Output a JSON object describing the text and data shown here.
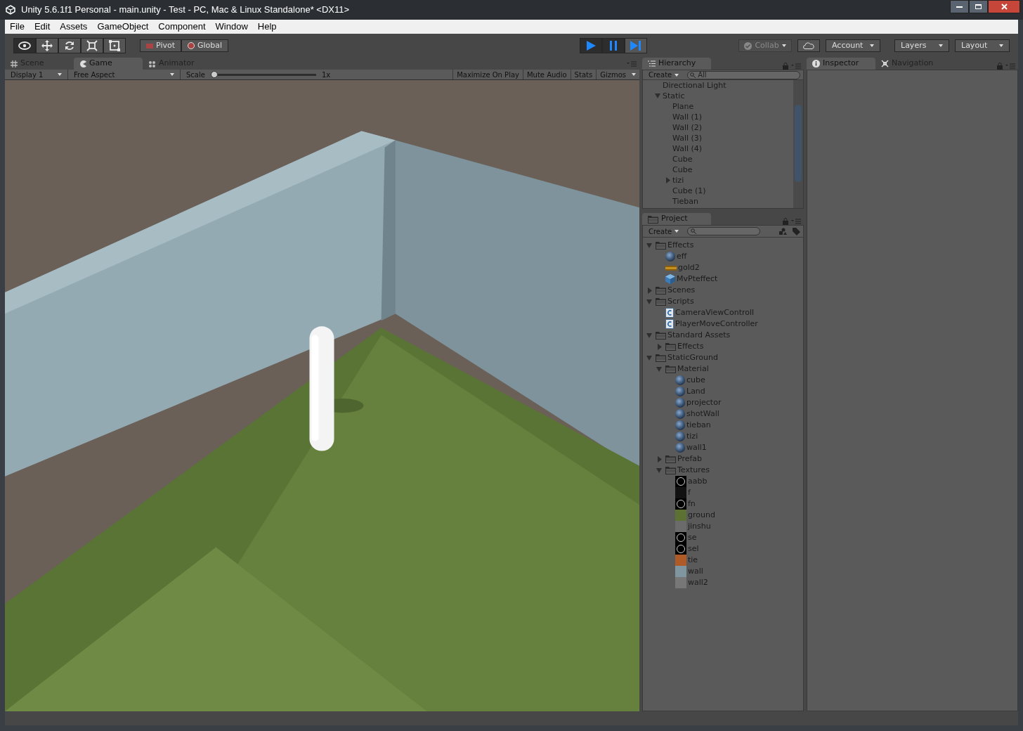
{
  "window": {
    "title": "Unity 5.6.1f1 Personal - main.unity - Test - PC, Mac & Linux Standalone* <DX11>"
  },
  "menu": [
    "File",
    "Edit",
    "Assets",
    "GameObject",
    "Component",
    "Window",
    "Help"
  ],
  "tools": [
    {
      "kind": "view",
      "selected": true
    },
    {
      "kind": "move",
      "selected": false
    },
    {
      "kind": "rotate",
      "selected": false
    },
    {
      "kind": "scale",
      "selected": false
    },
    {
      "kind": "rect",
      "selected": false
    }
  ],
  "pivot": {
    "pivot": "Pivot",
    "space": "Global"
  },
  "playback": [
    {
      "kind": "play",
      "on": true
    },
    {
      "kind": "pause",
      "on": true
    },
    {
      "kind": "step",
      "on": false
    }
  ],
  "right_toolbar": {
    "collab": "Collab",
    "collab_disabled": true,
    "account": "Account",
    "layers": "Layers",
    "layout": "Layout"
  },
  "view_tabs": [
    {
      "label": "Scene",
      "kind": "grid",
      "selected": false
    },
    {
      "label": "Game",
      "kind": "pacman",
      "selected": true
    },
    {
      "label": "Animator",
      "kind": "nodes",
      "selected": false
    }
  ],
  "game_bar": {
    "display": "Display 1",
    "aspect": "Free Aspect",
    "scale_label": "Scale",
    "scale_value": "1x",
    "level": 0,
    "buttons": [
      "Maximize On Play",
      "Mute Audio",
      "Stats"
    ],
    "gizmos": "Gizmos"
  },
  "hierarchy": {
    "tab": "Hierarchy",
    "create": "Create",
    "search_placeholder": "All",
    "items": [
      {
        "label": "Directional Light"
      },
      {
        "label": "Static",
        "expanded": true,
        "children": [
          {
            "label": "Plane"
          },
          {
            "label": "Wall (1)"
          },
          {
            "label": "Wall (2)"
          },
          {
            "label": "Wall (3)"
          },
          {
            "label": "Wall (4)"
          },
          {
            "label": "Cube"
          },
          {
            "label": "Cube"
          },
          {
            "label": "tizi",
            "expanded": false
          },
          {
            "label": "Cube (1)"
          },
          {
            "label": "Tieban"
          }
        ]
      }
    ]
  },
  "project": {
    "tab": "Project",
    "create": "Create",
    "items": [
      {
        "label": "Effects",
        "kind": "folder",
        "expanded": true,
        "children": [
          {
            "label": "eff",
            "kind": "material"
          },
          {
            "label": "gold2",
            "kind": "strip"
          },
          {
            "label": "MvPteffect",
            "kind": "prefab"
          }
        ]
      },
      {
        "label": "Scenes",
        "kind": "folder",
        "expanded": false
      },
      {
        "label": "Scripts",
        "kind": "folder",
        "expanded": true,
        "children": [
          {
            "label": "CameraViewControll",
            "kind": "script"
          },
          {
            "label": "PlayerMoveController",
            "kind": "script"
          }
        ]
      },
      {
        "label": "Standard Assets",
        "kind": "folder",
        "expanded": true,
        "children": [
          {
            "label": "Effects",
            "kind": "folder",
            "expanded": false
          }
        ]
      },
      {
        "label": "StaticGround",
        "kind": "folder",
        "expanded": true,
        "children": [
          {
            "label": "Material",
            "kind": "folder",
            "expanded": true,
            "children": [
              {
                "label": "cube",
                "kind": "material"
              },
              {
                "label": "Land",
                "kind": "material"
              },
              {
                "label": "projector",
                "kind": "material"
              },
              {
                "label": "shotWall",
                "kind": "material"
              },
              {
                "label": "tieban",
                "kind": "material"
              },
              {
                "label": "tizi",
                "kind": "material"
              },
              {
                "label": "wall1",
                "kind": "material"
              }
            ]
          },
          {
            "label": "Prefab",
            "kind": "folder",
            "expanded": false
          },
          {
            "label": "Textures",
            "kind": "folder",
            "expanded": true,
            "children": [
              {
                "label": "aabb",
                "kind": "texture",
                "color": "#000000",
                "ring": true
              },
              {
                "label": "f",
                "kind": "texture",
                "color": "#111111",
                "ring": false
              },
              {
                "label": "fn",
                "kind": "texture",
                "color": "#000000",
                "ring": true
              },
              {
                "label": "ground",
                "kind": "texture",
                "color": "#5d7132",
                "ring": false
              },
              {
                "label": "jinshu",
                "kind": "texture",
                "color": "#6b6b6b",
                "ring": false
              },
              {
                "label": "se",
                "kind": "texture",
                "color": "#000000",
                "ring": true
              },
              {
                "label": "sel",
                "kind": "texture",
                "color": "#000000",
                "ring": true
              },
              {
                "label": "tie",
                "kind": "texture",
                "color": "#b05a28",
                "ring": false
              },
              {
                "label": "wall",
                "kind": "texture",
                "color": "#7f96a0",
                "ring": false
              },
              {
                "label": "wall2",
                "kind": "texture",
                "color": "#777777",
                "ring": false
              }
            ]
          }
        ]
      }
    ]
  },
  "inspector_tabs": [
    {
      "label": "Inspector",
      "kind": "info",
      "selected": true
    },
    {
      "label": "Navigation",
      "kind": "nav",
      "selected": false
    }
  ]
}
